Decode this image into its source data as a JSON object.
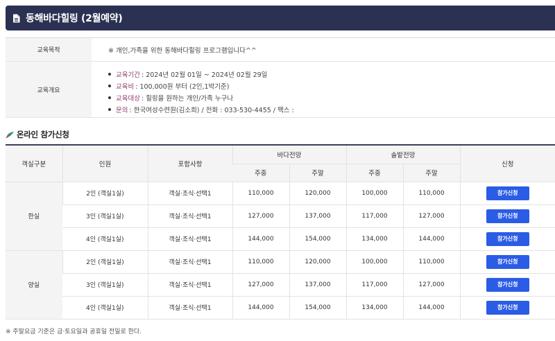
{
  "header": {
    "title": "동해바다힐링 (2월예약)",
    "icon": "document-icon"
  },
  "info": {
    "purpose_label": "교육목적",
    "purpose_value": "※ 개인,가족을 위한 동해바다힐링 프로그램입니다^^",
    "overview_label": "교육개요",
    "overview_items": [
      {
        "key": "교육기간",
        "value": " : 2024년 02월 01일 ~ 2024년 02월 29일"
      },
      {
        "key": "교육비",
        "value": " : 100,000원 부터 (2인,1박기준)"
      },
      {
        "key": "교육대상",
        "value": " : 힐링을 원하는 개인/가족 누구나"
      },
      {
        "key": "문의",
        "value": " : 한국여성수련원(김소희) / 전화 : 033-530-4455 / 팩스 :"
      }
    ],
    "accent_color": "#8e3b6b"
  },
  "section": {
    "title": "온라인 참가신청",
    "icon": "leaf-icon"
  },
  "table": {
    "headers": {
      "room_type": "객실구분",
      "people": "인원",
      "includes": "포함사항",
      "sea_view": "바다전망",
      "pine_view": "솔밭전망",
      "weekday": "주중",
      "weekend": "주말",
      "apply": "신청"
    },
    "groups": [
      {
        "name": "한실",
        "rows": [
          {
            "people": "2인 (객실1실)",
            "includes": "객실·조식·선택1",
            "sea_weekday": "110,000",
            "sea_weekend": "120,000",
            "pine_weekday": "100,000",
            "pine_weekend": "110,000",
            "button": "참가신청"
          },
          {
            "people": "3인 (객실1실)",
            "includes": "객실·조식·선택1",
            "sea_weekday": "127,000",
            "sea_weekend": "137,000",
            "pine_weekday": "117,000",
            "pine_weekend": "127,000",
            "button": "참가신청"
          },
          {
            "people": "4인 (객실1실)",
            "includes": "객실·조식·선택1",
            "sea_weekday": "144,000",
            "sea_weekend": "154,000",
            "pine_weekday": "134,000",
            "pine_weekend": "144,000",
            "button": "참가신청"
          }
        ]
      },
      {
        "name": "양실",
        "rows": [
          {
            "people": "2인 (객실1실)",
            "includes": "객실·조식·선택1",
            "sea_weekday": "110,000",
            "sea_weekend": "120,000",
            "pine_weekday": "100,000",
            "pine_weekend": "110,000",
            "button": "참가신청"
          },
          {
            "people": "3인 (객실1실)",
            "includes": "객실·조식·선택1",
            "sea_weekday": "127,000",
            "sea_weekend": "137,000",
            "pine_weekday": "117,000",
            "pine_weekend": "127,000",
            "button": "참가신청"
          },
          {
            "people": "4인 (객실1실)",
            "includes": "객실·조식·선택1",
            "sea_weekday": "144,000",
            "sea_weekend": "154,000",
            "pine_weekday": "134,000",
            "pine_weekend": "144,000",
            "button": "참가신청"
          }
        ]
      }
    ],
    "button_color": "#2b5ce6"
  },
  "footnote": "※ 주말요금 기준은 금·토요일과 공휴일 전일로 한다."
}
